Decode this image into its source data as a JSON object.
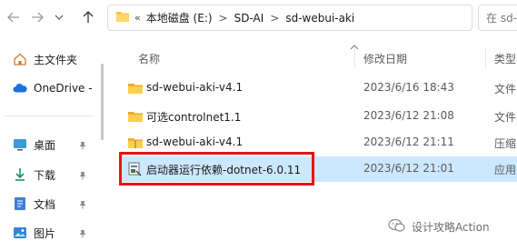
{
  "navigation": {
    "back_icon": "arrow-left-icon",
    "forward_icon": "arrow-right-icon",
    "recent_icon": "chevron-down-icon",
    "up_icon": "arrow-up-icon"
  },
  "address_bar": {
    "overflow": "«",
    "segments": [
      "本地磁盘 (E:)",
      "SD-AI",
      "sd-webui-aki"
    ],
    "separator": ">"
  },
  "search": {
    "placeholder": "在 sd-..."
  },
  "sidebar": {
    "items": [
      {
        "label": "主文件夹",
        "icon": "home-icon"
      },
      {
        "label": "OneDrive -",
        "icon": "cloud-icon"
      },
      {
        "label": "桌面",
        "icon": "desktop-icon",
        "pinned": true
      },
      {
        "label": "下载",
        "icon": "download-icon",
        "pinned": true
      },
      {
        "label": "文档",
        "icon": "document-icon",
        "pinned": true
      },
      {
        "label": "图片",
        "icon": "picture-icon",
        "pinned": true
      }
    ]
  },
  "columns": {
    "name": "名称",
    "modified": "修改日期",
    "type": "类型"
  },
  "files": [
    {
      "name": "sd-webui-aki-v4.1",
      "modified": "2023/6/16 18:43",
      "type": "文件",
      "icon": "folder-icon",
      "selected": false
    },
    {
      "name": "可选controlnet1.1",
      "modified": "2023/6/12 21:08",
      "type": "文件",
      "icon": "folder-icon",
      "selected": false
    },
    {
      "name": "sd-webui-aki-v4.1",
      "modified": "2023/6/12 21:11",
      "type": "压缩",
      "icon": "zip-folder-icon",
      "selected": false
    },
    {
      "name": "启动器运行依赖-dotnet-6.0.11",
      "modified": "2023/6/12 21:01",
      "type": "应用",
      "icon": "installer-icon",
      "selected": true
    }
  ],
  "watermark": {
    "text": "设计攻略Action",
    "icon": "wechat-icon"
  },
  "colors": {
    "selection": "#cce8ff",
    "highlight_border": "#e8121a",
    "folder": "#f5c242"
  }
}
